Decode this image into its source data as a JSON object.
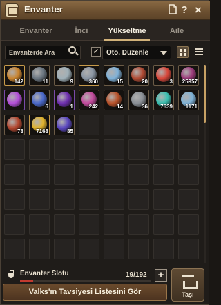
{
  "window": {
    "title": "Envanter",
    "icons": [
      "bag-icon",
      "page-icon",
      "help-icon",
      "close-icon"
    ],
    "help_label": "?",
    "close_label": "×"
  },
  "tabs": [
    {
      "label": "Envanter",
      "active": false
    },
    {
      "label": "İnci",
      "active": false
    },
    {
      "label": "Yükseltme",
      "active": true
    },
    {
      "label": "Aile",
      "active": false
    }
  ],
  "filters": {
    "search_placeholder": "Envanterde Ara",
    "auto_sort_checked": true,
    "check_mark": "✓",
    "sort_label": "Oto. Düzenle"
  },
  "items": [
    {
      "count": "142",
      "color": "#c9842f",
      "rarity": "gold"
    },
    {
      "count": "11",
      "color": "#6a7580",
      "rarity": "normal"
    },
    {
      "count": "9",
      "color": "#9fb0b8",
      "rarity": "normal"
    },
    {
      "count": "360",
      "color": "#8a95a3",
      "rarity": "gold"
    },
    {
      "count": "15",
      "color": "#7fb1d8",
      "rarity": "normal"
    },
    {
      "count": "20",
      "color": "#b04a33",
      "rarity": "normal"
    },
    {
      "count": "3",
      "color": "#d8473a",
      "rarity": "normal"
    },
    {
      "count": "25957",
      "color": "#9c3a7a",
      "rarity": "normal"
    },
    {
      "count": "",
      "color": "#b44fd8",
      "rarity": "purple"
    },
    {
      "count": "6",
      "color": "#4a68c9",
      "rarity": "normal"
    },
    {
      "count": "1",
      "color": "#6f2fb0",
      "rarity": "purple"
    },
    {
      "count": "242",
      "color": "#c24a9c",
      "rarity": "gold"
    },
    {
      "count": "14",
      "color": "#b8522a",
      "rarity": "normal"
    },
    {
      "count": "36",
      "color": "#8a8f95",
      "rarity": "normal"
    },
    {
      "count": "7639",
      "color": "#3bbfb0",
      "rarity": "normal"
    },
    {
      "count": "1171",
      "color": "#7fb2d6",
      "rarity": "normal"
    },
    {
      "count": "78",
      "color": "#b3462e",
      "rarity": "normal"
    },
    {
      "count": "7168",
      "color": "#e0b22c",
      "rarity": "gold"
    },
    {
      "count": "85",
      "color": "#5a46c0",
      "rarity": "normal"
    }
  ],
  "slots": {
    "label": "Envanter Slotu",
    "count_text": "19/192",
    "used_fraction": 0.099,
    "add_label": "+"
  },
  "recommend_button": "Valks'ın Tavsiyesi Listesini Gör",
  "move_button": "Taşı"
}
